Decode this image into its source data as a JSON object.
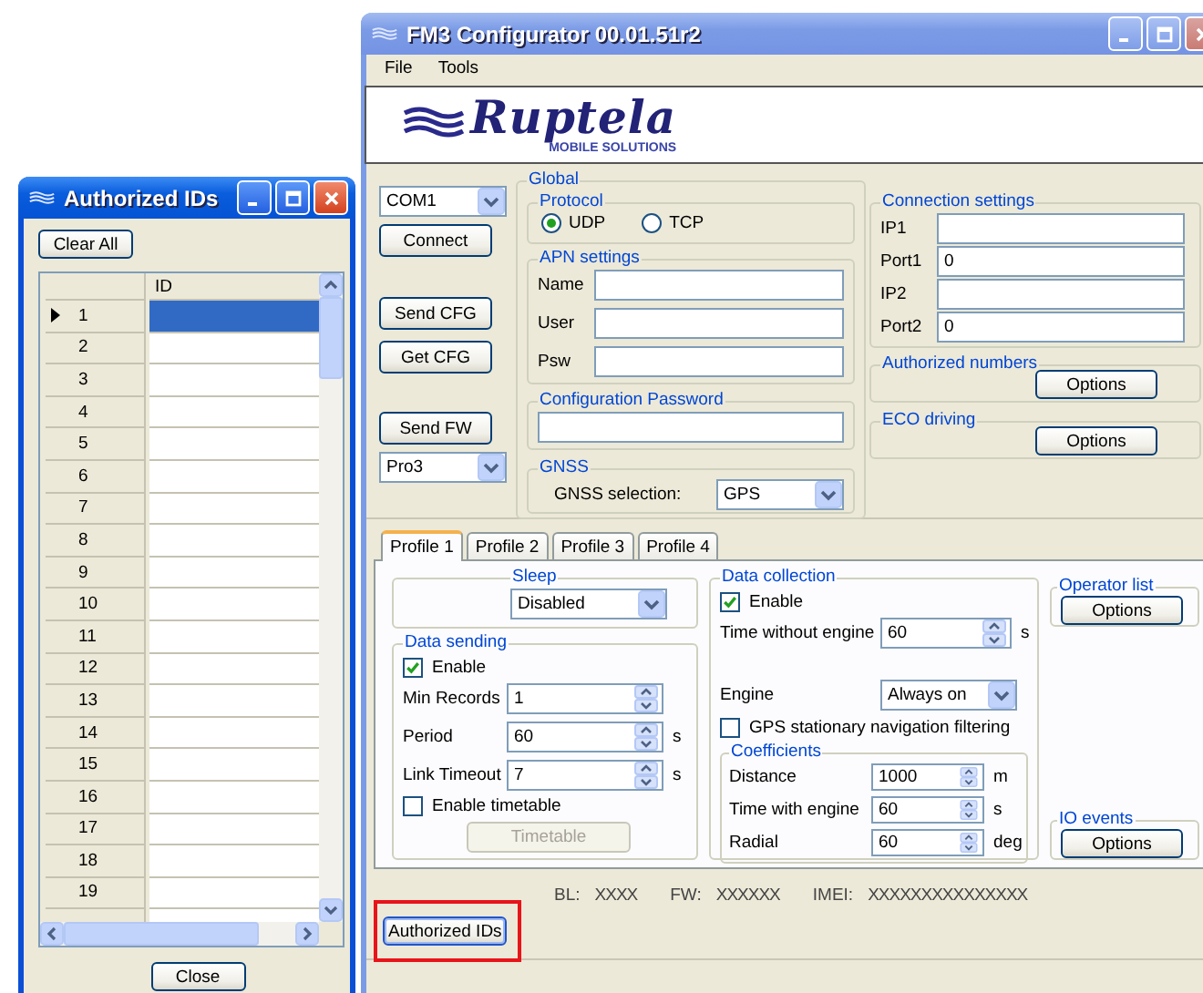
{
  "authorized_ids_window": {
    "title": "Authorized IDs",
    "clear_button": "Clear All",
    "column": "ID",
    "rows": [
      {
        "number": "1",
        "selected": true
      },
      {
        "number": "2",
        "selected": false
      },
      {
        "number": "3",
        "selected": false
      },
      {
        "number": "4",
        "selected": false
      },
      {
        "number": "5",
        "selected": false
      },
      {
        "number": "6",
        "selected": false
      },
      {
        "number": "7",
        "selected": false
      },
      {
        "number": "8",
        "selected": false
      },
      {
        "number": "9",
        "selected": false
      },
      {
        "number": "10",
        "selected": false
      },
      {
        "number": "11",
        "selected": false
      },
      {
        "number": "12",
        "selected": false
      },
      {
        "number": "13",
        "selected": false
      },
      {
        "number": "14",
        "selected": false
      },
      {
        "number": "15",
        "selected": false
      },
      {
        "number": "16",
        "selected": false
      },
      {
        "number": "17",
        "selected": false
      },
      {
        "number": "18",
        "selected": false
      },
      {
        "number": "19",
        "selected": false
      }
    ],
    "close_button": "Close"
  },
  "main_window": {
    "title": "FM3 Configurator 00.01.51r2",
    "menu": [
      "File",
      "Tools"
    ],
    "logo": {
      "wordmark": "Ruptela",
      "tagline": "MOBILE SOLUTIONS"
    },
    "port": "COM1",
    "connect_button": "Connect",
    "send_cfg_button": "Send CFG",
    "get_cfg_button": "Get CFG",
    "send_fw_button": "Send FW",
    "device": "Pro3",
    "global": {
      "title": "Global",
      "protocol": {
        "title": "Protocol",
        "options": [
          {
            "label": "UDP",
            "selected": true
          },
          {
            "label": "TCP",
            "selected": false
          }
        ]
      },
      "apn": {
        "title": "APN settings",
        "fields": [
          {
            "label": "Name"
          },
          {
            "label": "User"
          },
          {
            "label": "Psw"
          }
        ]
      },
      "config_password": {
        "title": "Configuration Password"
      },
      "gnss": {
        "title": "GNSS",
        "label": "GNSS selection:",
        "value": "GPS"
      }
    },
    "connection": {
      "title": "Connection settings",
      "fields": [
        {
          "label": "IP1"
        },
        {
          "label": "Port1",
          "value": "0"
        },
        {
          "label": "IP2"
        },
        {
          "label": "Port2",
          "value": "0"
        }
      ]
    },
    "authorized_numbers": {
      "title": "Authorized numbers",
      "button": "Options"
    },
    "eco_driving": {
      "title": "ECO driving",
      "button": "Options"
    },
    "tabs": [
      {
        "label": "Profile 1",
        "selected": true
      },
      {
        "label": "Profile 2",
        "selected": false
      },
      {
        "label": "Profile 3",
        "selected": false
      },
      {
        "label": "Profile 4",
        "selected": false
      }
    ],
    "sleep": {
      "title": "Sleep",
      "value": "Disabled"
    },
    "data_sending": {
      "title": "Data sending",
      "enable": {
        "label": "Enable",
        "checked": true
      },
      "fields": [
        {
          "label": "Min Records",
          "value": "1"
        },
        {
          "label": "Period",
          "value": "60",
          "unit": "s"
        },
        {
          "label": "Link Timeout",
          "value": "7",
          "unit": "s"
        }
      ],
      "timetable": {
        "label": "Enable timetable",
        "checked": false
      },
      "timetable_button": {
        "label": "Timetable",
        "disabled": true
      }
    },
    "data_collection": {
      "title": "Data collection",
      "enable": {
        "label": "Enable",
        "checked": true
      },
      "time_without_engine": {
        "label": "Time without engine",
        "value": "60",
        "unit": "s"
      },
      "engine": {
        "label": "Engine",
        "value": "Always on"
      },
      "gps_filter": {
        "label": "GPS stationary navigation filtering",
        "checked": false
      },
      "coefficients": {
        "title": "Coefficients",
        "fields": [
          {
            "label": "Distance",
            "value": "1000",
            "unit": "m"
          },
          {
            "label": "Time with engine",
            "value": "60",
            "unit": "s"
          },
          {
            "label": "Radial",
            "value": "60",
            "unit": "deg"
          }
        ]
      }
    },
    "operator_list": {
      "title": "Operator list",
      "button": "Options"
    },
    "io_events": {
      "title": "IO events",
      "button": "Options"
    },
    "status": [
      {
        "label": "BL:",
        "value": "XXXX"
      },
      {
        "label": "FW:",
        "value": "XXXXXX"
      },
      {
        "label": "IMEI:",
        "value": "XXXXXXXXXXXXXXX"
      }
    ],
    "authorized_ids_button": {
      "label": "Authorized IDs",
      "highlighted": true
    }
  }
}
